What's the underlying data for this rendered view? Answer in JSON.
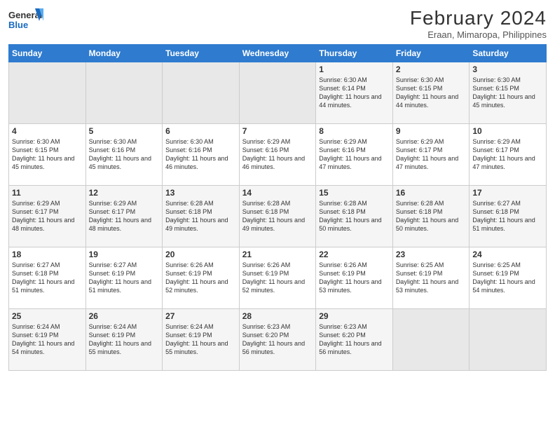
{
  "logo": {
    "general": "General",
    "blue": "Blue"
  },
  "header": {
    "title": "February 2024",
    "subtitle": "Eraan, Mimaropa, Philippines"
  },
  "weekdays": [
    "Sunday",
    "Monday",
    "Tuesday",
    "Wednesday",
    "Thursday",
    "Friday",
    "Saturday"
  ],
  "weeks": [
    [
      {
        "day": "",
        "info": ""
      },
      {
        "day": "",
        "info": ""
      },
      {
        "day": "",
        "info": ""
      },
      {
        "day": "",
        "info": ""
      },
      {
        "day": "1",
        "info": "Sunrise: 6:30 AM\nSunset: 6:14 PM\nDaylight: 11 hours\nand 44 minutes."
      },
      {
        "day": "2",
        "info": "Sunrise: 6:30 AM\nSunset: 6:15 PM\nDaylight: 11 hours\nand 44 minutes."
      },
      {
        "day": "3",
        "info": "Sunrise: 6:30 AM\nSunset: 6:15 PM\nDaylight: 11 hours\nand 45 minutes."
      }
    ],
    [
      {
        "day": "4",
        "info": "Sunrise: 6:30 AM\nSunset: 6:15 PM\nDaylight: 11 hours\nand 45 minutes."
      },
      {
        "day": "5",
        "info": "Sunrise: 6:30 AM\nSunset: 6:16 PM\nDaylight: 11 hours\nand 45 minutes."
      },
      {
        "day": "6",
        "info": "Sunrise: 6:30 AM\nSunset: 6:16 PM\nDaylight: 11 hours\nand 46 minutes."
      },
      {
        "day": "7",
        "info": "Sunrise: 6:29 AM\nSunset: 6:16 PM\nDaylight: 11 hours\nand 46 minutes."
      },
      {
        "day": "8",
        "info": "Sunrise: 6:29 AM\nSunset: 6:16 PM\nDaylight: 11 hours\nand 47 minutes."
      },
      {
        "day": "9",
        "info": "Sunrise: 6:29 AM\nSunset: 6:17 PM\nDaylight: 11 hours\nand 47 minutes."
      },
      {
        "day": "10",
        "info": "Sunrise: 6:29 AM\nSunset: 6:17 PM\nDaylight: 11 hours\nand 47 minutes."
      }
    ],
    [
      {
        "day": "11",
        "info": "Sunrise: 6:29 AM\nSunset: 6:17 PM\nDaylight: 11 hours\nand 48 minutes."
      },
      {
        "day": "12",
        "info": "Sunrise: 6:29 AM\nSunset: 6:17 PM\nDaylight: 11 hours\nand 48 minutes."
      },
      {
        "day": "13",
        "info": "Sunrise: 6:28 AM\nSunset: 6:18 PM\nDaylight: 11 hours\nand 49 minutes."
      },
      {
        "day": "14",
        "info": "Sunrise: 6:28 AM\nSunset: 6:18 PM\nDaylight: 11 hours\nand 49 minutes."
      },
      {
        "day": "15",
        "info": "Sunrise: 6:28 AM\nSunset: 6:18 PM\nDaylight: 11 hours\nand 50 minutes."
      },
      {
        "day": "16",
        "info": "Sunrise: 6:28 AM\nSunset: 6:18 PM\nDaylight: 11 hours\nand 50 minutes."
      },
      {
        "day": "17",
        "info": "Sunrise: 6:27 AM\nSunset: 6:18 PM\nDaylight: 11 hours\nand 51 minutes."
      }
    ],
    [
      {
        "day": "18",
        "info": "Sunrise: 6:27 AM\nSunset: 6:18 PM\nDaylight: 11 hours\nand 51 minutes."
      },
      {
        "day": "19",
        "info": "Sunrise: 6:27 AM\nSunset: 6:19 PM\nDaylight: 11 hours\nand 51 minutes."
      },
      {
        "day": "20",
        "info": "Sunrise: 6:26 AM\nSunset: 6:19 PM\nDaylight: 11 hours\nand 52 minutes."
      },
      {
        "day": "21",
        "info": "Sunrise: 6:26 AM\nSunset: 6:19 PM\nDaylight: 11 hours\nand 52 minutes."
      },
      {
        "day": "22",
        "info": "Sunrise: 6:26 AM\nSunset: 6:19 PM\nDaylight: 11 hours\nand 53 minutes."
      },
      {
        "day": "23",
        "info": "Sunrise: 6:25 AM\nSunset: 6:19 PM\nDaylight: 11 hours\nand 53 minutes."
      },
      {
        "day": "24",
        "info": "Sunrise: 6:25 AM\nSunset: 6:19 PM\nDaylight: 11 hours\nand 54 minutes."
      }
    ],
    [
      {
        "day": "25",
        "info": "Sunrise: 6:24 AM\nSunset: 6:19 PM\nDaylight: 11 hours\nand 54 minutes."
      },
      {
        "day": "26",
        "info": "Sunrise: 6:24 AM\nSunset: 6:19 PM\nDaylight: 11 hours\nand 55 minutes."
      },
      {
        "day": "27",
        "info": "Sunrise: 6:24 AM\nSunset: 6:19 PM\nDaylight: 11 hours\nand 55 minutes."
      },
      {
        "day": "28",
        "info": "Sunrise: 6:23 AM\nSunset: 6:20 PM\nDaylight: 11 hours\nand 56 minutes."
      },
      {
        "day": "29",
        "info": "Sunrise: 6:23 AM\nSunset: 6:20 PM\nDaylight: 11 hours\nand 56 minutes."
      },
      {
        "day": "",
        "info": ""
      },
      {
        "day": "",
        "info": ""
      }
    ]
  ]
}
